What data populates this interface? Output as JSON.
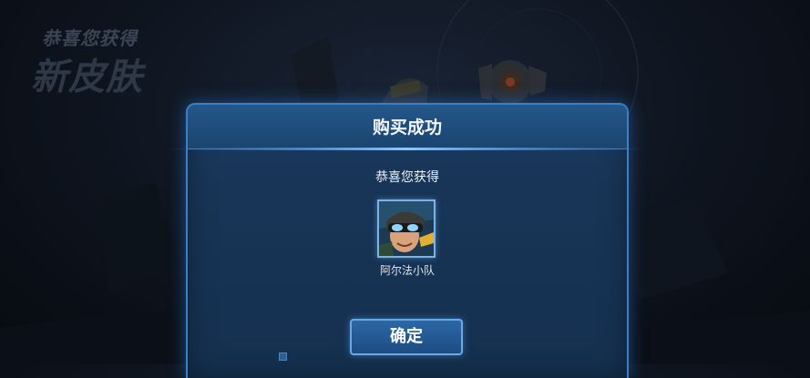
{
  "header": {
    "subtitle": "恭喜您获得",
    "title": "新皮肤"
  },
  "dialog": {
    "title": "购买成功",
    "message": "恭喜您获得",
    "item": {
      "name": "阿尔法小队",
      "icon": "hero-skin-portrait"
    },
    "confirm_label": "确定"
  },
  "colors": {
    "dialog_border": "#3c7fc2",
    "dialog_bg": "#183557",
    "button_bg": "#2c68a6"
  }
}
